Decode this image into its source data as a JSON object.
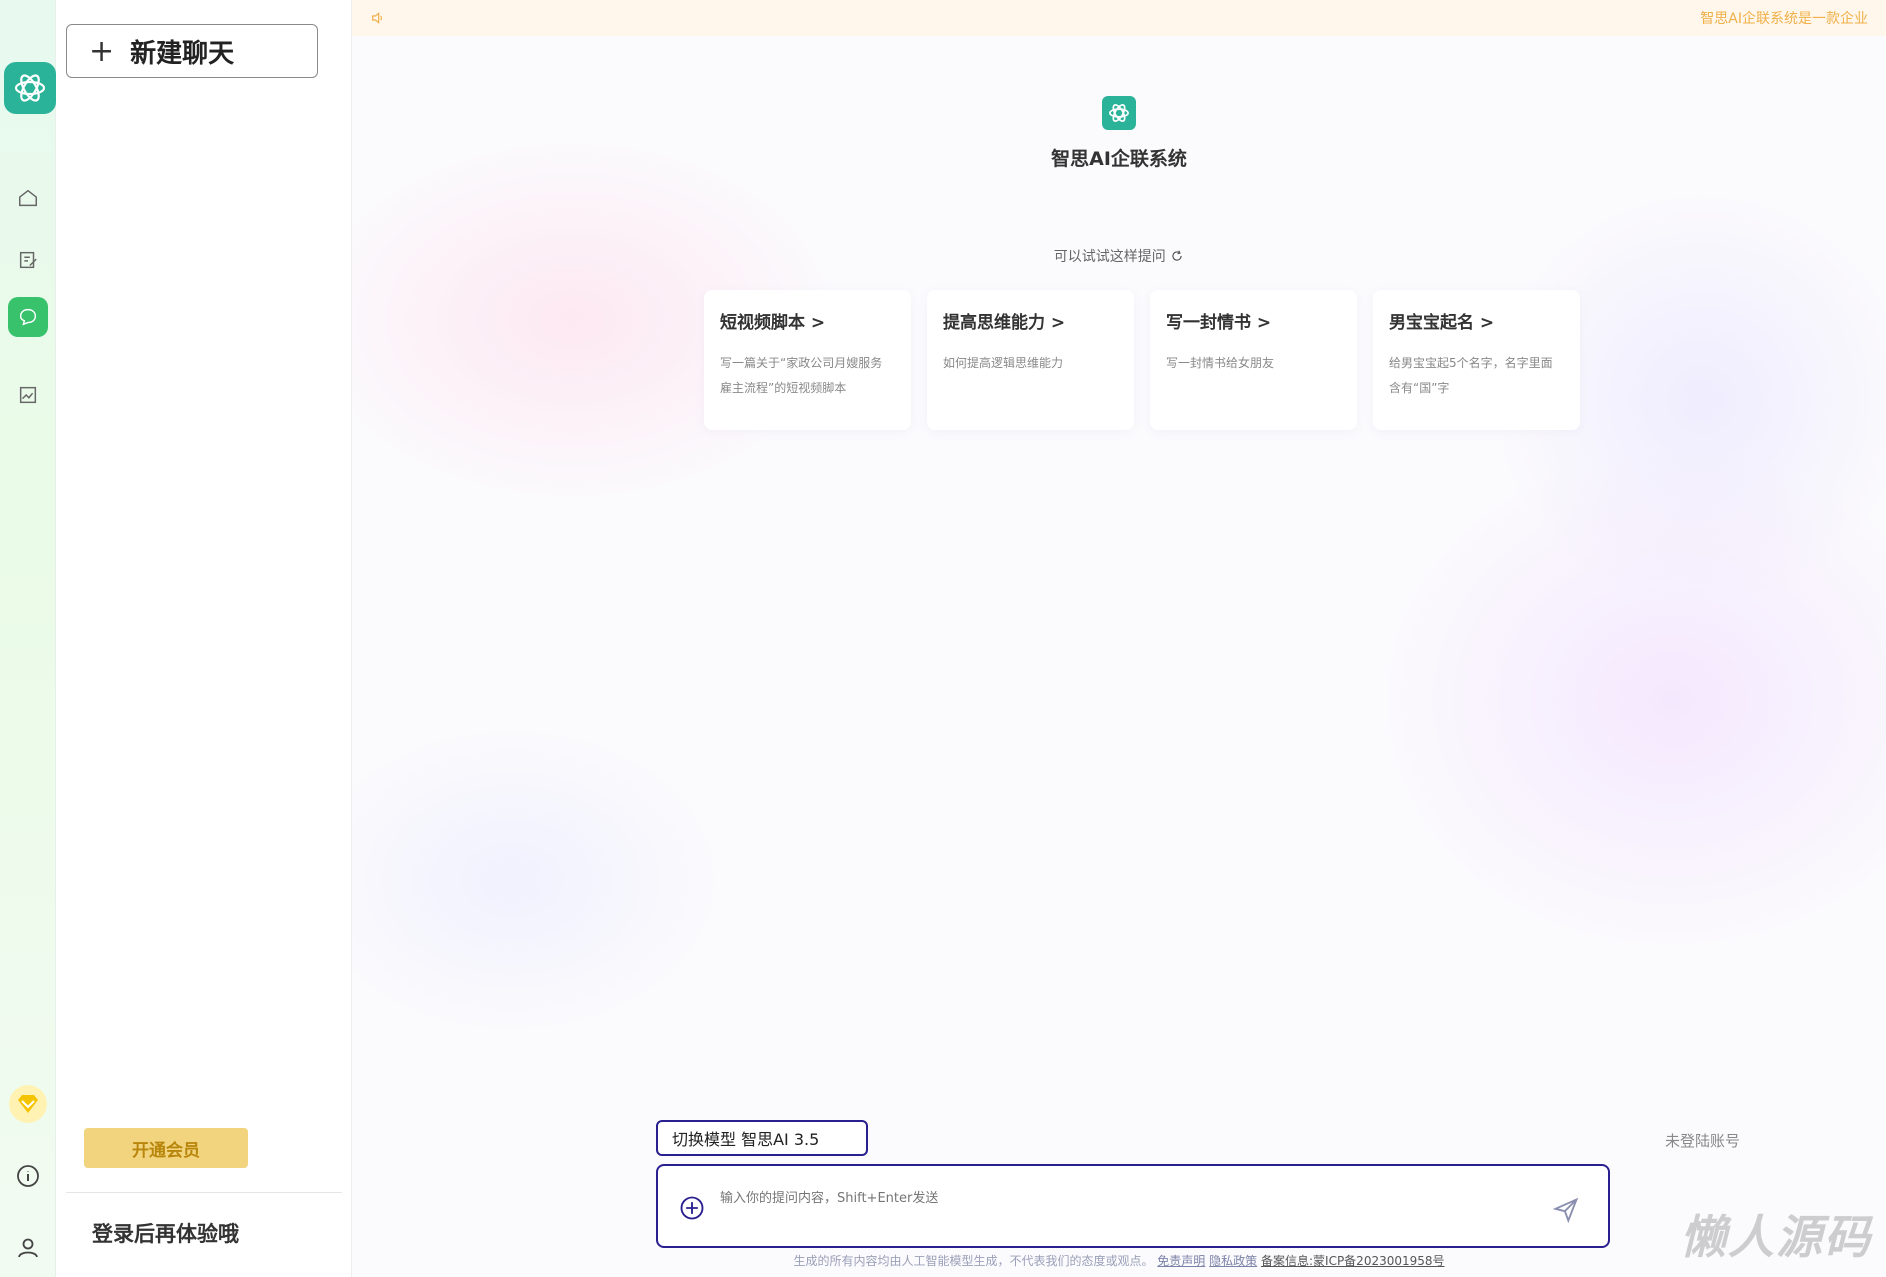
{
  "sidebar": {
    "new_chat_label": "新建聊天",
    "vip_label": "开通会员",
    "login_tip": "登录后再体验哦"
  },
  "rail": {
    "nav_items": [
      "home-icon",
      "edit-icon",
      "chat-icon",
      "image-icon"
    ],
    "active_item": "chat-icon",
    "bottom_items": [
      "vip-diamond-icon",
      "info-icon",
      "user-icon"
    ]
  },
  "notice": {
    "text": "智思AI企联系统是一款企业"
  },
  "brand": {
    "name": "智思AI企联系统"
  },
  "suggestions": {
    "label": "可以试试这样提问",
    "cards": [
      {
        "title": "短视频脚本 >",
        "desc_line1": "写一篇关于“家政公司月嫂服务",
        "desc_line2": "雇主流程”的短视频脚本"
      },
      {
        "title": "提高思维能力 >",
        "desc_line1": "如何提高逻辑思维能力",
        "desc_line2": ""
      },
      {
        "title": "写一封情书 >",
        "desc_line1": "写一封情书给女朋友",
        "desc_line2": ""
      },
      {
        "title": "男宝宝起名 >",
        "desc_line1": "给男宝宝起5个名字，名字里面",
        "desc_line2": "含有“国”字"
      }
    ]
  },
  "composer": {
    "model_switch_label": "切换模型 智思AI 3.5",
    "login_status": "未登陆账号",
    "placeholder": "输入你的提问内容，Shift+Enter发送"
  },
  "footer": {
    "disclaimer": "生成的所有内容均由人工智能模型生成，不代表我们的态度或观点。",
    "disclaimer_link": "免责声明",
    "privacy_link": "隐私政策",
    "icp": "备案信息:蒙ICP备2023001958号"
  },
  "watermark": "懒人源码",
  "colors": {
    "brand_green": "#2bb39a",
    "active_nav": "#37c26b",
    "input_border": "#2a1f8f",
    "notice_text": "#f0b04a",
    "vip_bg": "#f2d47f"
  }
}
